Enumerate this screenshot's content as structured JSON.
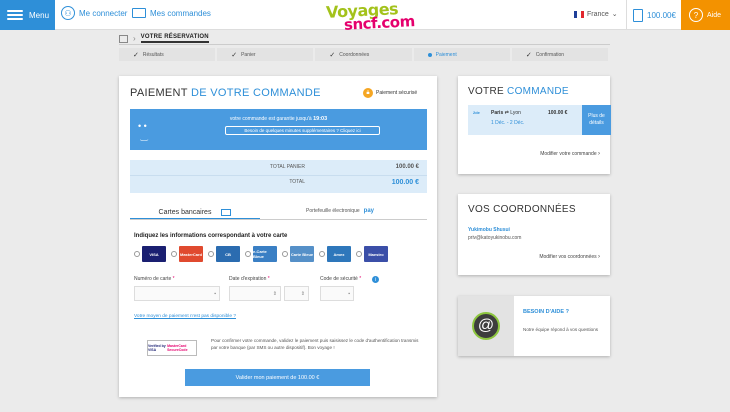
{
  "header": {
    "menu_label": "Menu",
    "connect_label": "Me connecter",
    "orders_label": "Mes commandes",
    "logo_line1": "Voyages",
    "logo_line2": "sncf.com",
    "lang_label": "France",
    "cart_total": "100.00€",
    "help_label": "Aide"
  },
  "breadcrumb": {
    "title": "VOTRE RÉSERVATION"
  },
  "steps": [
    {
      "label": "Résultats",
      "state": "done"
    },
    {
      "label": "Panier",
      "state": "done"
    },
    {
      "label": "Coordonnées",
      "state": "done"
    },
    {
      "label": "Paiement",
      "state": "active"
    },
    {
      "label": "Confirmation",
      "state": "todo"
    }
  ],
  "payment": {
    "title_1": "PAIEMENT",
    "title_2": "DE VOTRE COMMANDE",
    "secure_label": "Paiement sécurisé",
    "banner_text": "votre commande est garantie jusqu'à",
    "banner_time": "19:03",
    "banner_more": "Besoin de quelques minutes supplémentaires ? Cliquez ici",
    "total_panier_label": "TOTAL PANIER",
    "total_panier_value": "100.00 €",
    "total_label": "TOTAL",
    "total_value": "100.00 €",
    "tab_cards": "Cartes bancaires",
    "tab_wallet": "Portefeuille électronique",
    "tab_wallet_brand": "pay",
    "cards_title": "Indiquez les informations correspondant à votre carte",
    "cards": [
      {
        "label": "VISA",
        "color": "#1a1f71",
        "text_color": "#ffffff"
      },
      {
        "label": "MasterCard",
        "color": "#e04a2f",
        "text_color": "#ffffff"
      },
      {
        "label": "CB",
        "color": "#2b6cb0",
        "text_color": "#ffffff"
      },
      {
        "label": "e-Carte Bleue",
        "color": "#3a7fc4",
        "text_color": "#ffffff"
      },
      {
        "label": "Carte Bleue",
        "color": "#5590c8",
        "text_color": "#ffffff"
      },
      {
        "label": "Amex",
        "color": "#2e77bb",
        "text_color": "#ffffff"
      },
      {
        "label": "Maestro",
        "color": "#3b4fa8",
        "text_color": "#ffffff"
      }
    ],
    "card_number_label": "Numéro de carte",
    "expiry_label": "Date d'expiration",
    "cvv_label": "Code de sécurité",
    "not_listed": "Votre moyen de paiement n'est pas disponible ?",
    "vbv_1": "Verified by VISA",
    "vbv_2": "MasterCard SecureCode",
    "auth_text": "Pour confirmer votre commande, validez le paiement puis saisissez le code d'authentification transmis par votre banque (par SMS ou autre dispositif). Bon voyage !",
    "submit_label": "Valider mon paiement de 100.00 €"
  },
  "order": {
    "title_1": "VOTRE",
    "title_2": "COMMANDE",
    "mode": "2de",
    "from": "Paris",
    "to": "Lyon",
    "dates": "1 Déc. - 2 Déc.",
    "price": "100.00 €",
    "details_label": "Plus de détails",
    "modify_label": "Modifier votre commande"
  },
  "coordinates": {
    "title": "VOS COORDONNÉES",
    "name": "Yukimobu Shusui",
    "email": "priv@katoyukinobu.com",
    "modify_label": "Modifier vos coordonnées"
  },
  "help": {
    "title": "BESOIN D'AIDE ?",
    "description": "Notre équipe répond à vos questions"
  },
  "colors": {
    "accent": "#2e8fd8",
    "help_orange": "#f39200",
    "logo_green": "#a3c21b",
    "logo_pink": "#e5006d"
  }
}
